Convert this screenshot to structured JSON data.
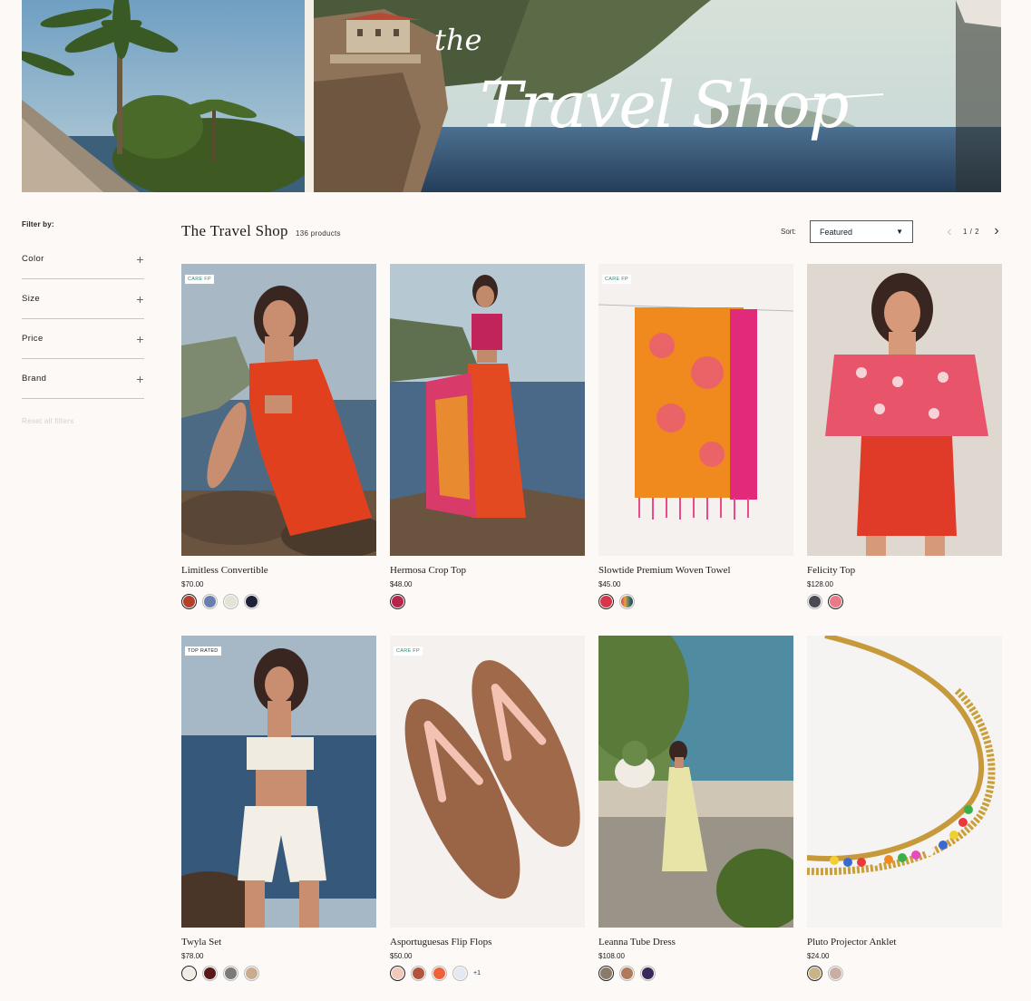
{
  "hero": {
    "script_word_1": "the",
    "script_word_2": "Travel Shop"
  },
  "sidebar": {
    "title": "Filter by:",
    "filters": [
      {
        "label": "Color"
      },
      {
        "label": "Size"
      },
      {
        "label": "Price"
      },
      {
        "label": "Brand"
      }
    ],
    "reset": "Reset all filters"
  },
  "header": {
    "title": "The Travel Shop",
    "count": "136 products",
    "sort_label": "Sort:",
    "sort_value": "Featured",
    "pager": "1 / 2"
  },
  "products": [
    {
      "name": "Limitless Convertible",
      "price": "$70.00",
      "badge": "CARE FP",
      "swatches": [
        "#b5402a",
        "#6a7fb0",
        "#e3e4d6",
        "#1d2238"
      ],
      "more": ""
    },
    {
      "name": "Hermosa Crop Top",
      "price": "$48.00",
      "badge": "",
      "swatches": [
        "#b8254a"
      ],
      "more": ""
    },
    {
      "name": "Slowtide Premium Woven Towel",
      "price": "$45.00",
      "badge": "CARE FP",
      "swatches": [
        "#d8344a",
        "#d08a3a"
      ],
      "more": ""
    },
    {
      "name": "Felicity Top",
      "price": "$128.00",
      "badge": "",
      "swatches": [
        "#4a4a52",
        "#e87a8a"
      ],
      "more": ""
    },
    {
      "name": "Twyla Set",
      "price": "$78.00",
      "badge": "TOP RATED",
      "swatches": [
        "#f3ece4",
        "#5a1818",
        "#7a7a7a",
        "#c9ab92"
      ],
      "more": ""
    },
    {
      "name": "Asportuguesas Flip Flops",
      "price": "$50.00",
      "badge": "CARE FP",
      "swatches": [
        "#f3c9bb",
        "#b2543a",
        "#f0623a",
        "#e4e8f3"
      ],
      "more": "+1"
    },
    {
      "name": "Leanna Tube Dress",
      "price": "$108.00",
      "badge": "",
      "swatches": [
        "#8a7a6a",
        "#b07a5a",
        "#3a2a5a"
      ],
      "more": ""
    },
    {
      "name": "Pluto Projector Anklet",
      "price": "$24.00",
      "badge": "",
      "swatches": [
        "#c9b488",
        "#c9aea4"
      ],
      "more": ""
    }
  ]
}
